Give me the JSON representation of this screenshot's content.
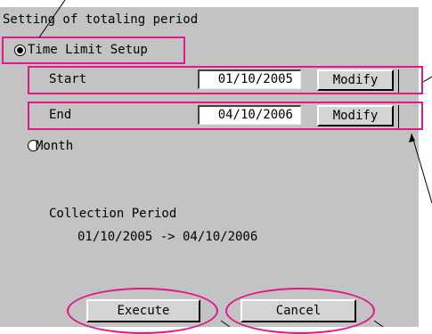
{
  "section_title": "Setting of totaling period",
  "options": {
    "time_limit_label": "Time Limit Setup",
    "month_label": "Month",
    "selected": "time_limit"
  },
  "start": {
    "label": "Start",
    "value": "01/10/2005",
    "button": "Modify"
  },
  "end": {
    "label": "End",
    "value": "04/10/2006",
    "button": "Modify"
  },
  "collection": {
    "label": "Collection Period",
    "range": "01/10/2005 -> 04/10/2006"
  },
  "actions": {
    "execute": "Execute",
    "cancel": "Cancel"
  },
  "colors": {
    "panel": "#c3c3c3",
    "highlight": "#e0188a"
  }
}
